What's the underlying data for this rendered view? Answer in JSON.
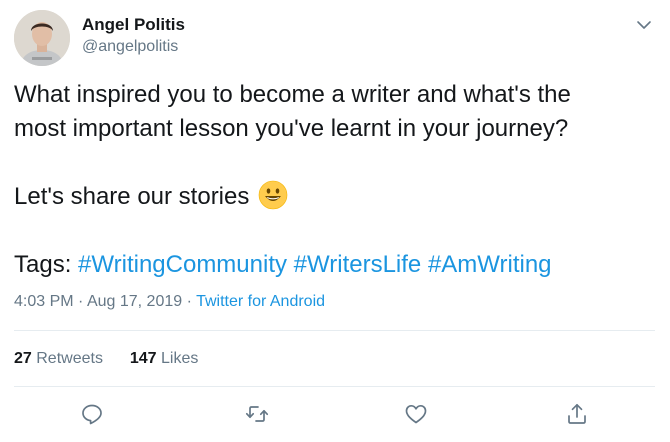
{
  "author": {
    "name": "Angel Politis",
    "handle": "@angelpolitis"
  },
  "tweet": {
    "line1": "What inspired you to become a writer and what's the",
    "line2": "most important lesson you've learnt in your journey?",
    "line3": "Let's share our stories",
    "tags_prefix": "Tags:",
    "hashtags": [
      "#WritingCommunity",
      "#WritersLife",
      "#AmWriting"
    ]
  },
  "meta": {
    "time": "4:03 PM",
    "separator": "·",
    "date": "Aug 17, 2019",
    "source": "Twitter for Android"
  },
  "stats": {
    "retweets_count": "27",
    "retweets_label": "Retweets",
    "likes_count": "147",
    "likes_label": "Likes"
  },
  "icons": {
    "more": "chevron-down-icon",
    "reply": "reply-icon",
    "retweet": "retweet-icon",
    "like": "heart-icon",
    "share": "share-icon",
    "emoji": "smiling-face-emoji"
  },
  "colors": {
    "link": "#1b95e0",
    "secondary_text": "#657786",
    "primary_text": "#14171a",
    "divider": "#e6ecf0"
  }
}
